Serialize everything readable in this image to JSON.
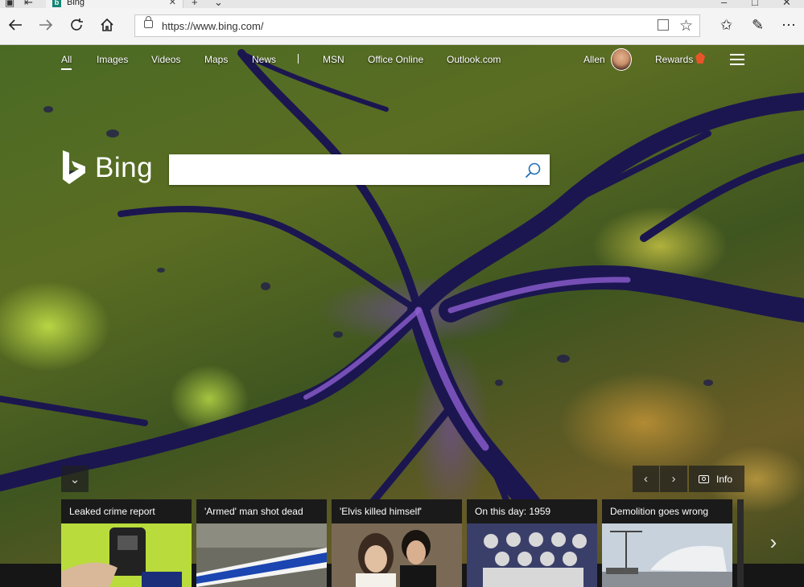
{
  "browser": {
    "tab": {
      "title": "Bing",
      "favicon": "bing-favicon"
    },
    "url": "https://www.bing.com/"
  },
  "header": {
    "nav": [
      "All",
      "Images",
      "Videos",
      "Maps",
      "News",
      "MSN",
      "Office Online",
      "Outlook.com"
    ],
    "user_name": "Allen",
    "rewards_label": "Rewards"
  },
  "search": {
    "logo_text": "Bing",
    "value": "",
    "placeholder": ""
  },
  "controls": {
    "collapse": "⌄",
    "prev": "‹",
    "next": "›",
    "info_label": "Info"
  },
  "news": [
    {
      "caption": "Leaked crime report",
      "image": "police-radio"
    },
    {
      "caption": "'Armed' man shot dead",
      "image": "police-tape"
    },
    {
      "caption": "'Elvis killed himself'",
      "image": "elvis-wedding"
    },
    {
      "caption": "On this day: 1959",
      "image": "astronauts"
    },
    {
      "caption": "Demolition goes wrong",
      "image": "demolition-crane"
    }
  ],
  "colors": {
    "brand": "#138574",
    "water": "#1f1a55",
    "river_highlight": "#8a5ec8",
    "land": "#5a6b26"
  }
}
